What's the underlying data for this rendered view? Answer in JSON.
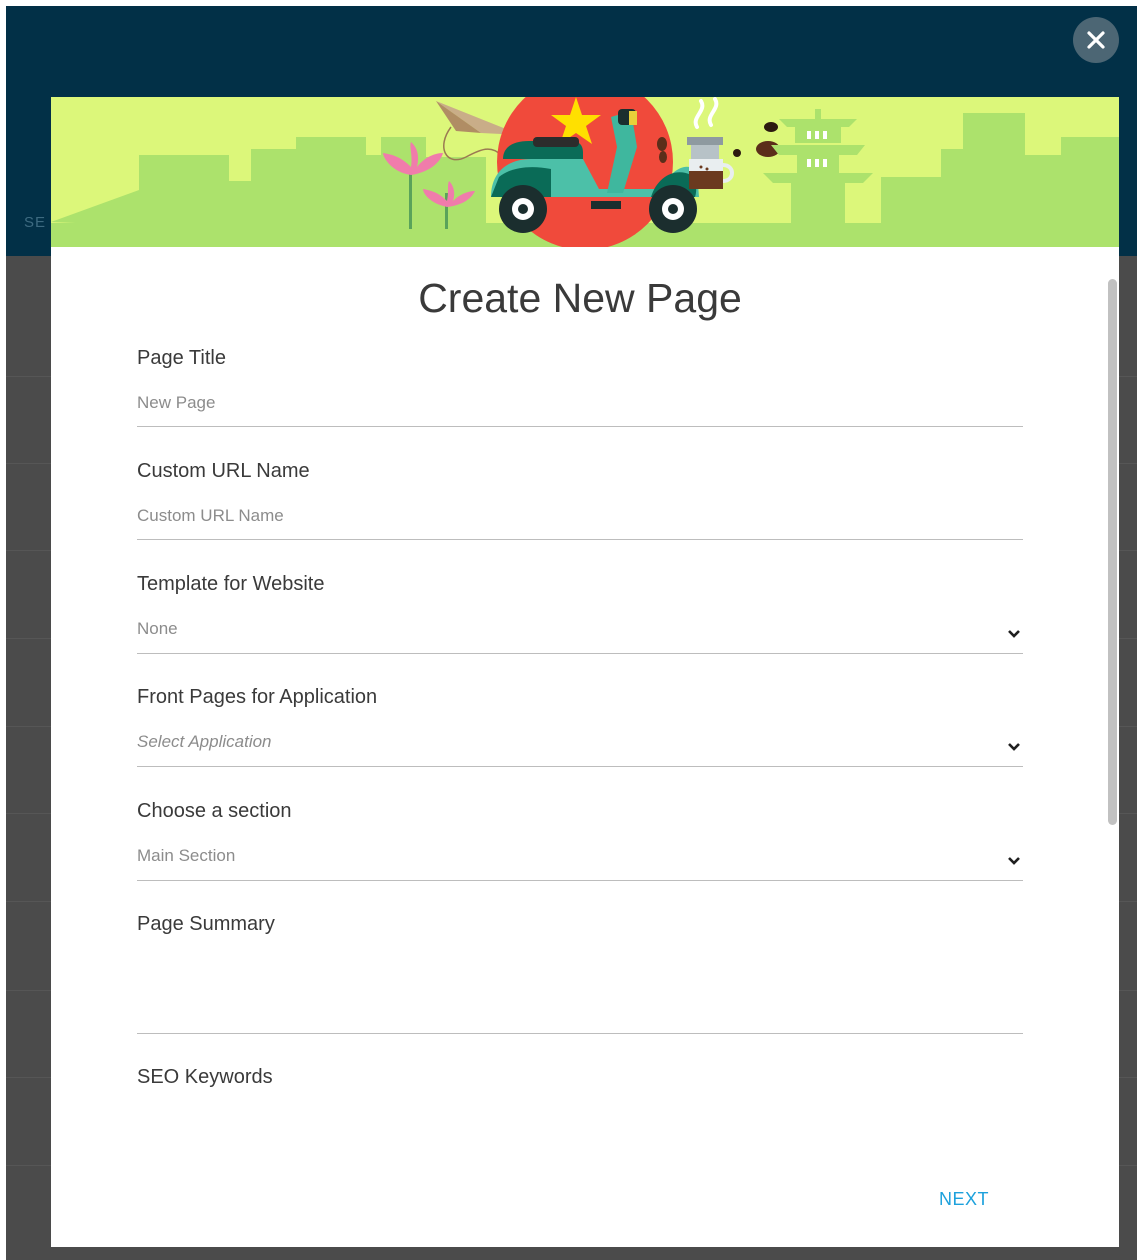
{
  "backdrop": {
    "partial_text": "SE"
  },
  "dialog": {
    "title": "Create New Page",
    "next_label": "NEXT",
    "fields": {
      "page_title": {
        "label": "Page Title",
        "placeholder": "New Page"
      },
      "custom_url": {
        "label": "Custom URL Name",
        "placeholder": "Custom URL Name"
      },
      "template": {
        "label": "Template for Website",
        "value": "None"
      },
      "front_pages": {
        "label": "Front Pages for Application",
        "placeholder": "Select Application"
      },
      "section": {
        "label": "Choose a section",
        "value": "Main Section"
      },
      "summary": {
        "label": "Page Summary"
      },
      "seo": {
        "label": "SEO Keywords"
      }
    }
  },
  "icons": {
    "close": "close-icon",
    "dropdown": "chevron-down-icon"
  },
  "colors": {
    "backdrop_top": "#023047",
    "backdrop_bottom": "#4b4b4b",
    "accent": "#1da1dc",
    "banner_sky": "#dcf77a",
    "banner_ground": "#ace26c",
    "sun": "#f04a3b"
  }
}
